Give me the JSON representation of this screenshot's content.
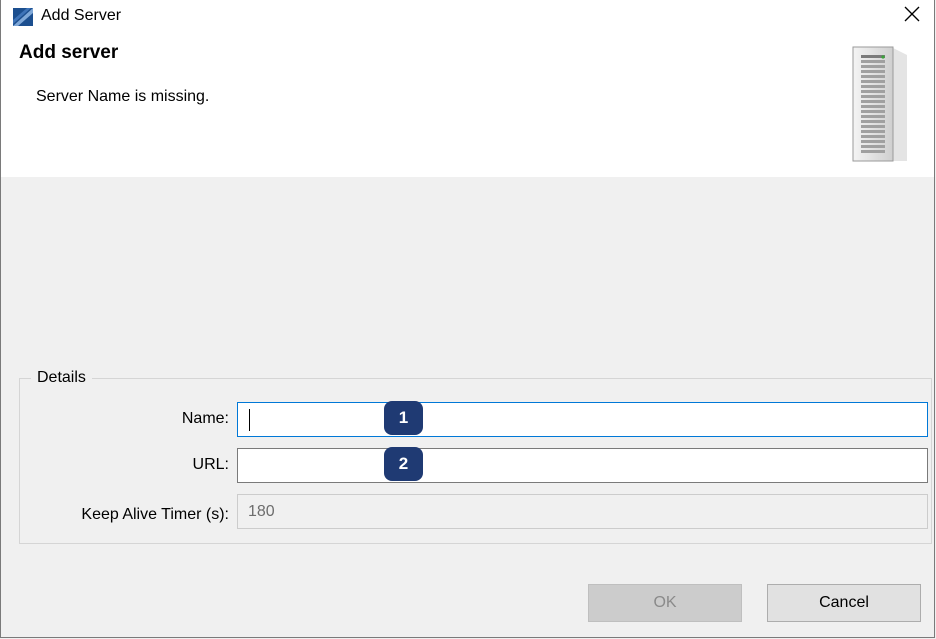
{
  "window": {
    "title": "Add Server",
    "app_icon": "eclipse-app-icon",
    "close_icon": "close-icon"
  },
  "banner": {
    "title": "Add server",
    "message": "Server Name is missing.",
    "icon": "server-icon"
  },
  "details": {
    "group_label": "Details",
    "name": {
      "label": "Name:",
      "value": "",
      "focused": true
    },
    "url": {
      "label": "URL:",
      "value": ""
    },
    "keep_alive": {
      "label": "Keep Alive Timer (s):",
      "value": "180",
      "disabled": true
    }
  },
  "markers": [
    "1",
    "2"
  ],
  "buttons": {
    "ok": "OK",
    "cancel": "Cancel",
    "ok_disabled": true
  },
  "colors": {
    "marker": "#1f3a73",
    "focus_border": "#0078d7"
  }
}
